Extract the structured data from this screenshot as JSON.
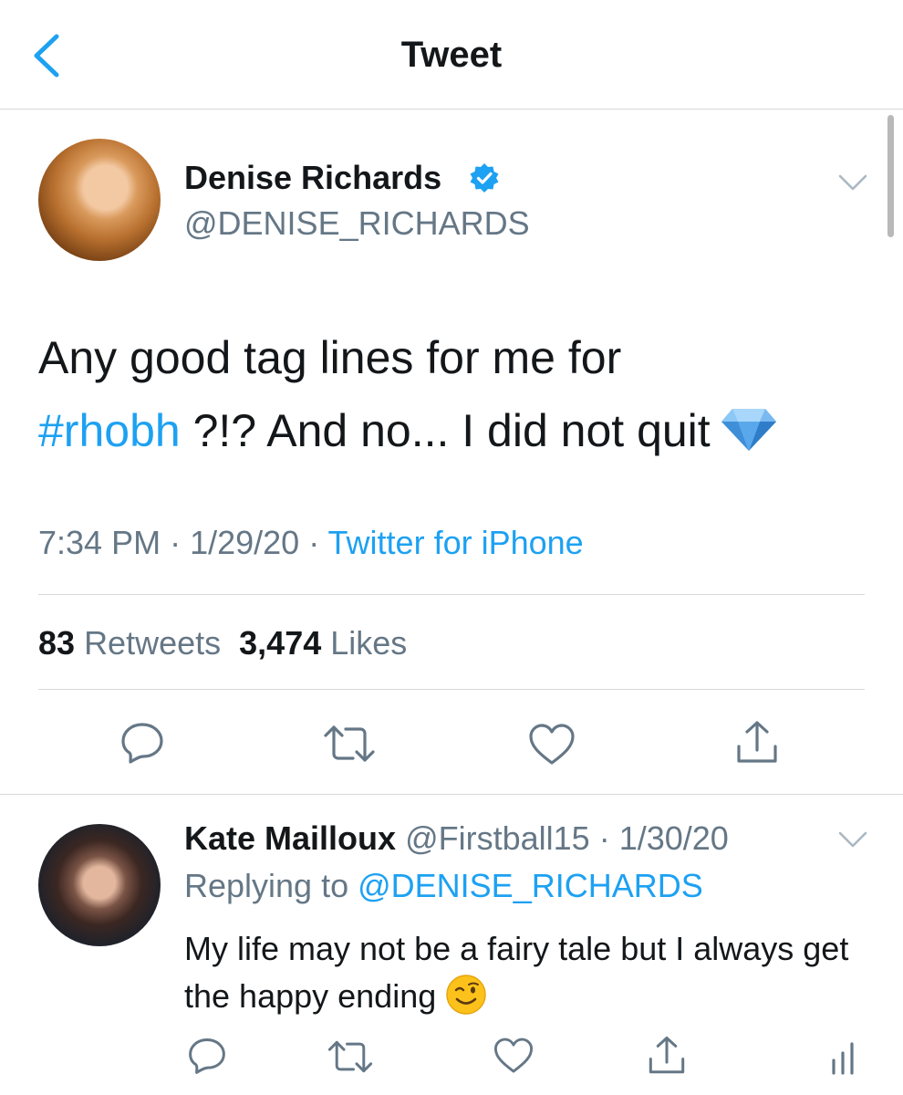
{
  "nav": {
    "title": "Tweet"
  },
  "tweet": {
    "author_name": "Denise Richards",
    "author_handle": "@DENISE_RICHARDS",
    "text_part1": "Any good tag lines for me for",
    "hashtag": "#rhobh",
    "text_part2": " ?!? And no... I did not quit",
    "emoji": "gem-stone-icon",
    "time": "7:34 PM",
    "date": "1/29/20",
    "separator": " · ",
    "source": "Twitter for iPhone",
    "retweets_count": "83",
    "retweets_label": "Retweets",
    "likes_count": "3,474",
    "likes_label": "Likes"
  },
  "reply": {
    "author_name": "Kate Mailloux",
    "author_handle": "@Firstball15",
    "date": "1/30/20",
    "separator": " · ",
    "replying_label": "Replying to ",
    "replying_to": "@DENISE_RICHARDS",
    "text": "My life may not be a fairy tale but I always get the happy ending",
    "emoji": "winking-face-icon"
  },
  "colors": {
    "accent": "#1da1f2",
    "secondary_text": "#657786",
    "primary_text": "#14171a",
    "divider": "#d6d9dc"
  }
}
